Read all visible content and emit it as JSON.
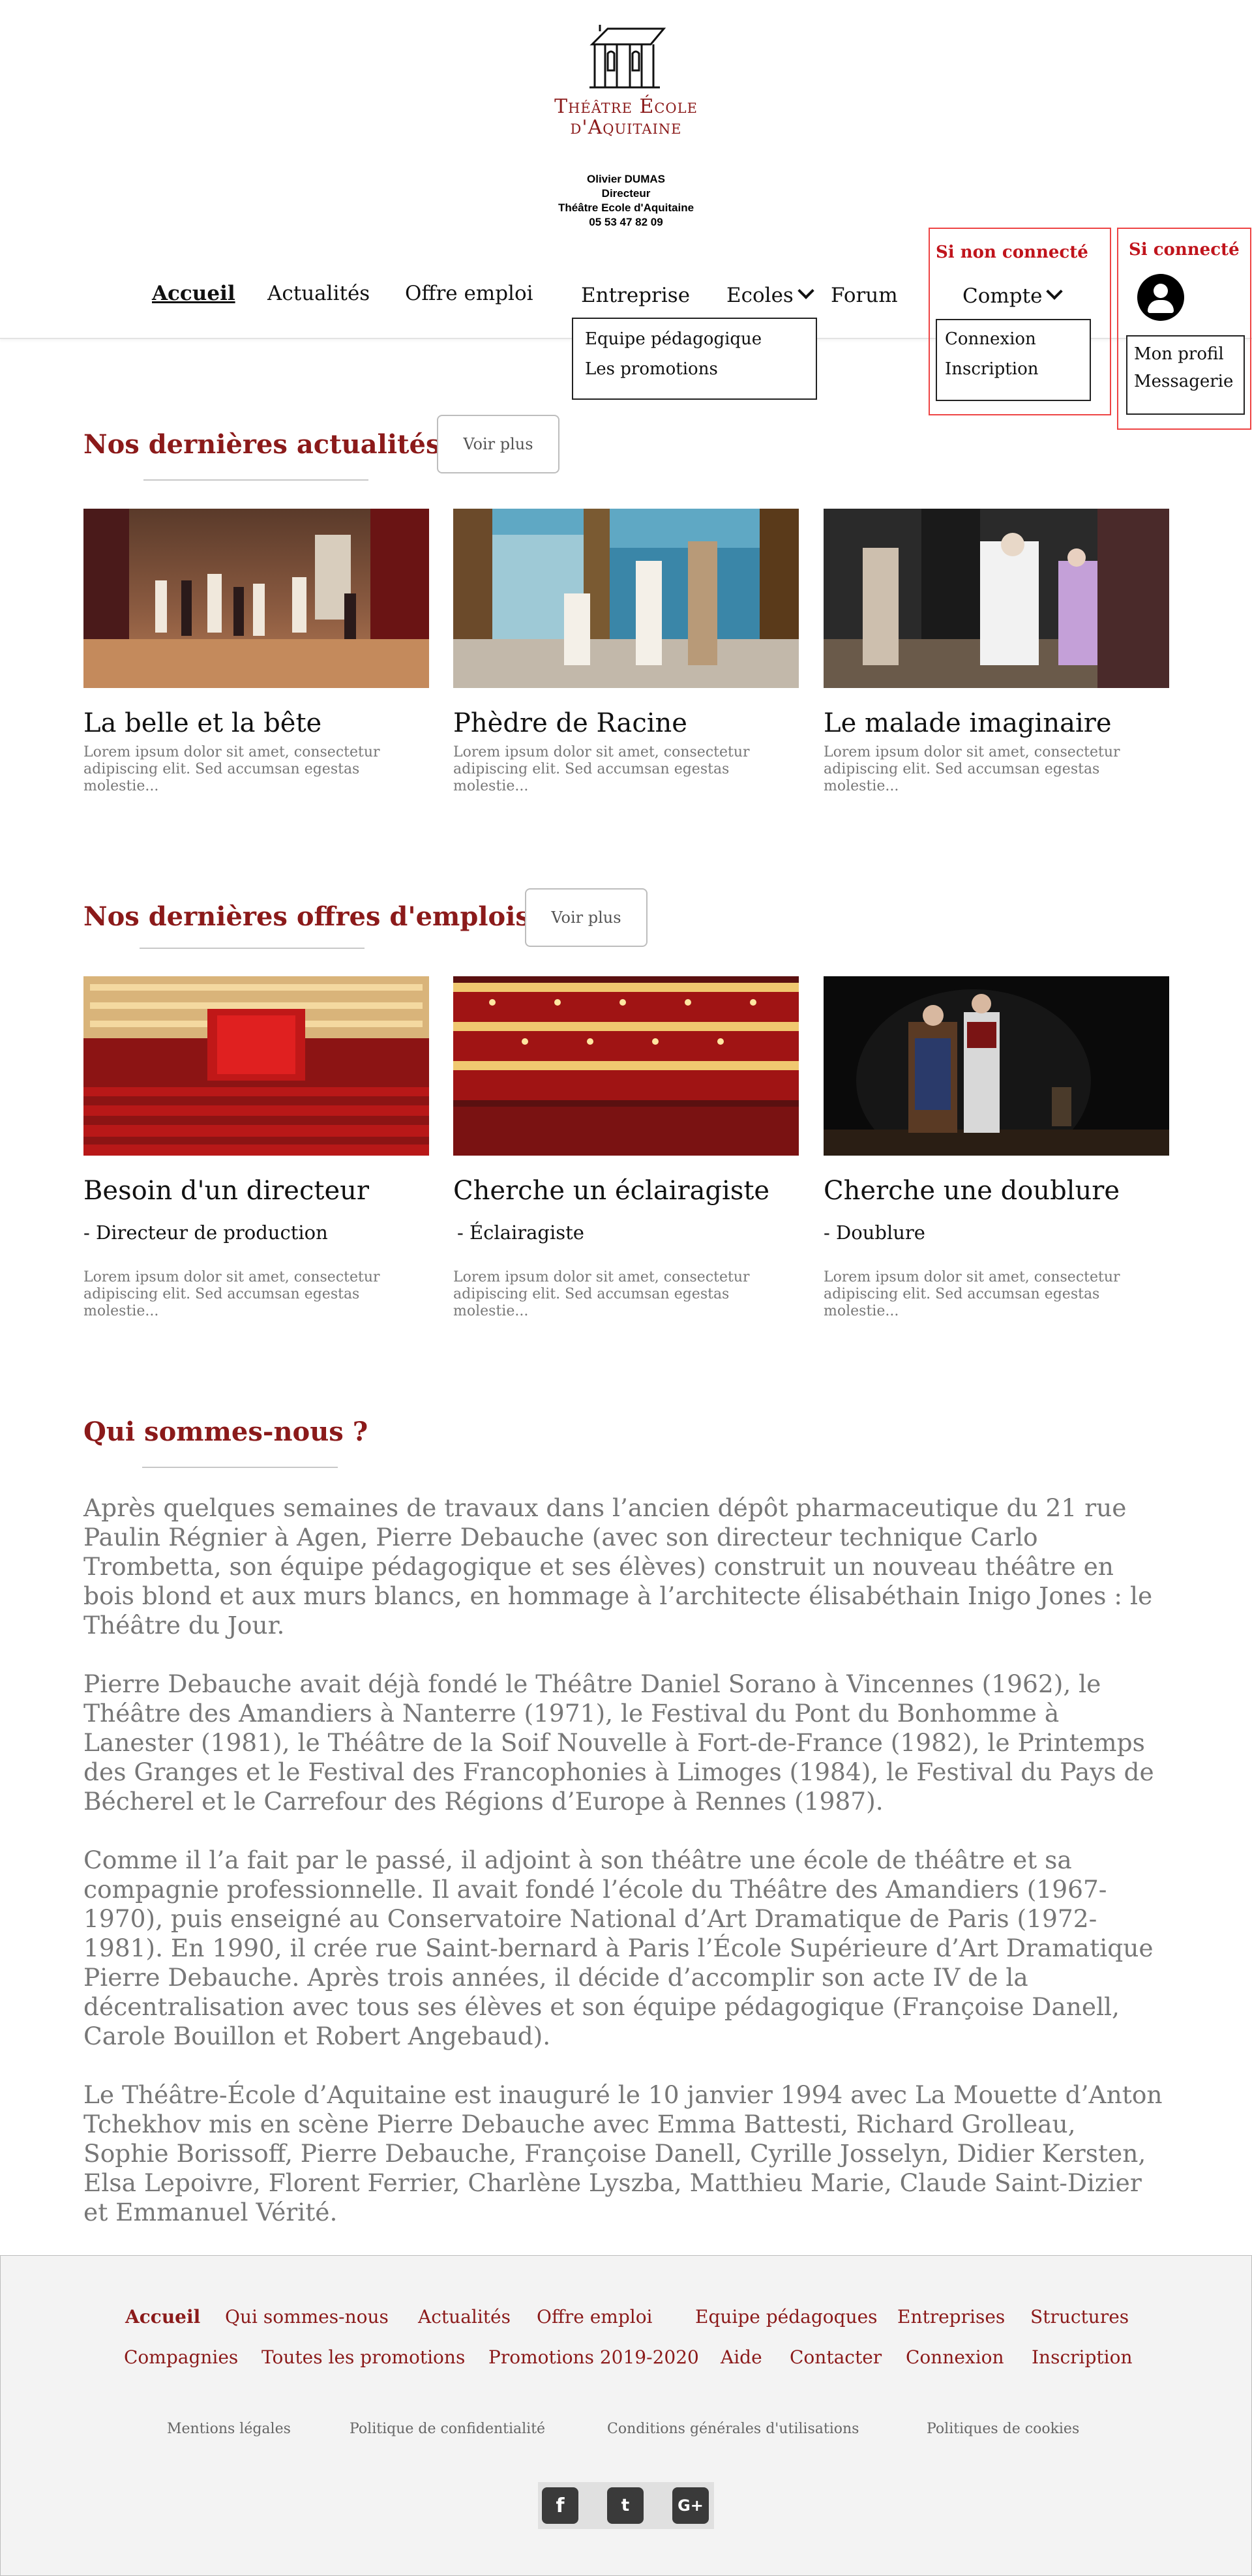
{
  "header": {
    "logo_line1": "Théâtre École",
    "logo_line2": "d'Aquitaine",
    "contact_name": "Olivier DUMAS",
    "contact_role": "Directeur",
    "contact_org": "Théâtre Ecole d'Aquitaine",
    "contact_phone": "05 53 47 82 09"
  },
  "nav": {
    "home": "Accueil",
    "news": "Actualités",
    "jobs": "Offre emploi",
    "company": "Entreprise",
    "schools": "Ecoles",
    "forum": "Forum",
    "account": "Compte"
  },
  "company_menu": [
    "Equipe pédagogique",
    "Les promotions"
  ],
  "not_connected": {
    "title": "Si non connecté",
    "items": [
      "Connexion",
      "Inscription"
    ]
  },
  "connected": {
    "title": "Si connecté",
    "items": [
      "Mon profil",
      "Messagerie"
    ]
  },
  "news": {
    "title": "Nos dernières actualités",
    "more": "Voir plus",
    "cards": [
      {
        "title": "La belle et la bête",
        "text": "Lorem ipsum dolor sit amet, consectetur adipiscing elit. Sed accumsan egestas molestie..."
      },
      {
        "title": "Phèdre de Racine",
        "text": "Lorem ipsum dolor sit amet, consectetur adipiscing elit. Sed accumsan egestas molestie..."
      },
      {
        "title": "Le malade imaginaire",
        "text": "Lorem ipsum dolor sit amet, consectetur adipiscing elit. Sed accumsan egestas molestie..."
      }
    ]
  },
  "jobs": {
    "title": "Nos dernières offres d'emplois",
    "more": "Voir plus",
    "cards": [
      {
        "title": "Besoin d'un directeur",
        "subtitle": "- Directeur de production",
        "text": "Lorem ipsum dolor sit amet, consectetur adipiscing elit. Sed accumsan egestas molestie..."
      },
      {
        "title": "Cherche un éclairagiste",
        "subtitle": "- Éclairagiste",
        "text": "Lorem ipsum dolor sit amet, consectetur adipiscing elit. Sed accumsan egestas molestie..."
      },
      {
        "title": "Cherche une doublure",
        "subtitle": "- Doublure",
        "text": "Lorem ipsum dolor sit amet, consectetur adipiscing elit. Sed accumsan egestas molestie..."
      }
    ]
  },
  "about": {
    "title": "Qui sommes-nous ?",
    "paragraphs": [
      "Après quelques semaines de travaux dans l’ancien dépôt pharmaceutique du 21 rue Paulin Régnier à Agen, Pierre Debauche (avec son directeur technique Carlo Trombetta, son équipe pédagogique et ses élèves) construit un nouveau théâtre en bois blond et aux murs blancs, en hommage à l’architecte élisabéthain Inigo Jones : le Théâtre du Jour.",
      "Pierre Debauche avait déjà fondé le Théâtre Daniel Sorano à Vincennes (1962), le Théâtre des Amandiers à Nanterre (1971), le Festival du Pont du Bonhomme à Lanester (1981), le Théâtre de la Soif Nouvelle à Fort-de-France (1982), le Printemps des Granges et le Festival des Francophonies à Limoges (1984), le Festival du Pays de Bécherel et le Carrefour des Régions d’Europe à Rennes (1987).",
      "Comme il l’a fait par le passé, il adjoint à son théâtre une école de théâtre et sa compagnie professionnelle. Il avait fondé l’école du Théâtre des Amandiers (1967-1970), puis enseigné au Conservatoire National d’Art Dramatique de Paris (1972-1981). En 1990, il crée rue Saint-bernard à Paris l’École Supérieure d’Art Dramatique Pierre Debauche. Après trois années, il décide d’accomplir son acte IV de la décentralisation avec tous ses élèves et son équipe pédagogique (Françoise Danell, Carole Bouillon et Robert Angebaud).",
      "Le Théâtre-École d’Aquitaine est inauguré le 10 janvier 1994 avec La Mouette d’Anton Tchekhov mis en scène Pierre Debauche avec Emma Battesti, Richard Grolleau, Sophie Borissoff, Pierre Debauche, Françoise Danell, Cyrille Josselyn, Didier Kersten, Elsa Lepoivre, Florent Ferrier, Charlène Lyszba, Matthieu Marie, Claude Saint-Dizier et Emmanuel Vérité."
    ]
  },
  "footer": {
    "row1": [
      "Accueil",
      "Qui sommes-nous",
      "Actualités",
      "Offre emploi",
      "Equipe pédagoques",
      "Entreprises",
      "Structures"
    ],
    "row2": [
      "Compagnies",
      "Toutes les promotions",
      "Promotions 2019-2020",
      "Aide",
      "Contacter",
      "Connexion",
      "Inscription"
    ],
    "legal": [
      "Mentions légales",
      "Politique de confidentialité",
      "Conditions générales d'utilisations",
      "Politiques de cookies"
    ],
    "social": [
      "f",
      "t",
      "G+"
    ]
  },
  "social_icons": [
    "facebook-icon",
    "twitter-icon",
    "google-plus-icon"
  ]
}
